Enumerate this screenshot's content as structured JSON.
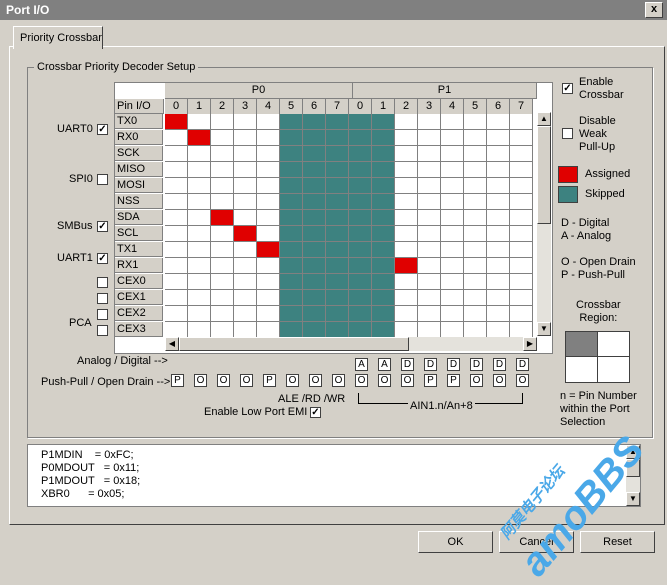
{
  "window": {
    "title": "Port I/O",
    "close_label": "x"
  },
  "tab": {
    "label": "Priority Crossbar"
  },
  "group": {
    "title": "Crossbar Priority Decoder Setup"
  },
  "grid": {
    "port_headers": [
      "P0",
      "P1"
    ],
    "pin_io_label": "Pin I/O",
    "pin_numbers": [
      "0",
      "1",
      "2",
      "3",
      "4",
      "5",
      "6",
      "7",
      "0",
      "1",
      "2",
      "3",
      "4",
      "5",
      "6",
      "7"
    ],
    "rows": [
      "TX0",
      "RX0",
      "SCK",
      "MISO",
      "MOSI",
      "NSS",
      "SDA",
      "SCL",
      "TX1",
      "RX1",
      "CEX0",
      "CEX1",
      "CEX2",
      "CEX3"
    ],
    "skipped_columns": [
      5,
      6,
      7,
      8,
      9
    ],
    "assigned": [
      [
        0,
        0
      ],
      [
        1,
        1
      ],
      [
        6,
        2
      ],
      [
        7,
        3
      ],
      [
        8,
        4
      ],
      [
        9,
        10
      ]
    ]
  },
  "peripherals": [
    {
      "label": "UART0",
      "checked": true
    },
    {
      "label": "SPI0",
      "checked": false
    },
    {
      "label": "SMBus",
      "checked": true
    },
    {
      "label": "UART1",
      "checked": true
    },
    {
      "label": "PCA",
      "checked": false
    }
  ],
  "cex_checks": [
    false,
    false,
    false,
    false
  ],
  "options": {
    "enable_crossbar": "Enable\nCrossbar",
    "enable_crossbar_checked": true,
    "disable_pullup": "Disable\nWeak\nPull-Up",
    "disable_pullup_checked": false
  },
  "legend": {
    "assigned": "Assigned",
    "skipped": "Skipped",
    "assigned_color": "#e00000",
    "skipped_color": "#3d8280",
    "digital": "D - Digital",
    "analog": "A - Analog",
    "open_drain": "O - Open Drain",
    "push_pull": "P - Push-Pull",
    "region_title": "Crossbar\nRegion:",
    "region_note": "n = Pin Number\nwithin the Port\nSelection"
  },
  "analog_digital": {
    "label": "Analog / Digital -->",
    "p1_values": [
      "A",
      "A",
      "D",
      "D",
      "D",
      "D",
      "D",
      "D"
    ]
  },
  "push_pull": {
    "label": "Push-Pull / Open Drain -->",
    "p0_values": [
      "P",
      "O",
      "O",
      "O",
      "P",
      "O",
      "O",
      "O"
    ],
    "p1_values": [
      "O",
      "O",
      "O",
      "P",
      "P",
      "O",
      "O",
      "O"
    ]
  },
  "ale_label": "ALE /RD /WR",
  "ain_label": "AIN1.n/An+8",
  "low_emi": {
    "label": "Enable Low Port EMI",
    "checked": true
  },
  "code_lines": [
    "P1MDIN    = 0xFC;",
    "P0MDOUT   = 0x11;",
    "P1MDOUT   = 0x18;",
    "XBR0      = 0x05;"
  ],
  "buttons": {
    "ok": "OK",
    "cancel": "Cancel",
    "reset": "Reset"
  },
  "watermark": {
    "text": "amoBBS",
    "chinese": "阿莫电子论坛"
  }
}
